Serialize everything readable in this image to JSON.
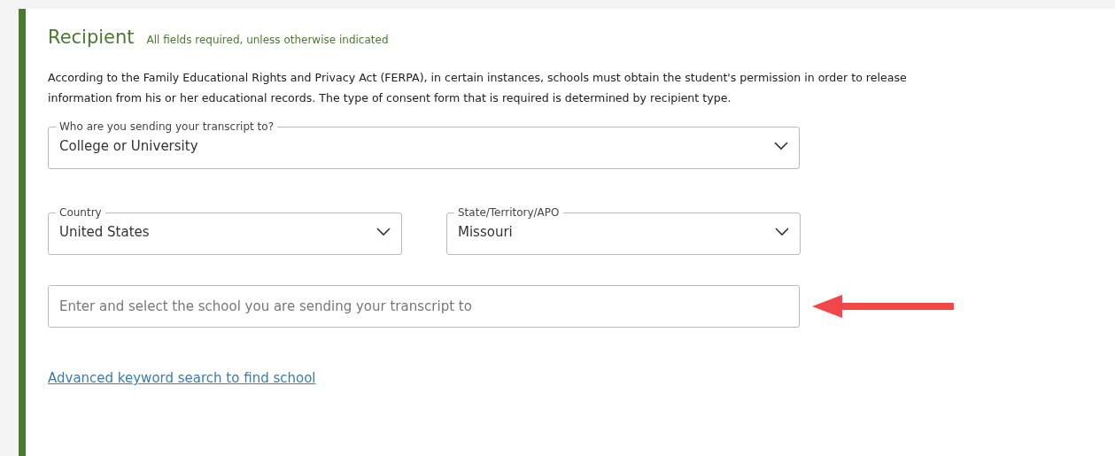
{
  "section": {
    "title": "Recipient",
    "note": "All fields required, unless otherwise indicated",
    "description": "According to the Family Educational Rights and Privacy Act (FERPA), in certain instances, schools must obtain the student's permission in order to release information from his or her educational records. The type of consent form that is required is determined by recipient type."
  },
  "rows": [
    [
      {
        "kind": "select",
        "label": "Who are you sending your transcript to?",
        "value": "College or University"
      }
    ],
    [
      {
        "kind": "select",
        "label": "Country",
        "value": "United States"
      },
      {
        "kind": "select",
        "label": "State/Territory/APO",
        "value": "Missouri"
      }
    ],
    [
      {
        "kind": "input",
        "placeholder": "Enter and select the school you are sending your transcript to",
        "annotated": true
      }
    ]
  ],
  "link": "Advanced keyword search to find school"
}
